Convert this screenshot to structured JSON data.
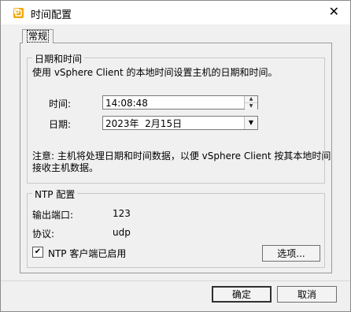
{
  "window": {
    "title": "时间配置",
    "close_glyph": "✕"
  },
  "tabs": [
    {
      "label": "常规"
    }
  ],
  "datetime_group": {
    "title": "日期和时间",
    "description": "使用 vSphere Client 的本地时间设置主机的日期和时间。",
    "time_label": "时间:",
    "time_value": "14:08:48",
    "date_label": "日期:",
    "date_value": "2023年  2月15日",
    "note_line1": "注意: 主机将处理日期和时间数据，以便 vSphere Client 按其本地时间",
    "note_line2": "接收主机数据。"
  },
  "ntp_group": {
    "title": "NTP 配置",
    "port_label": "输出端口:",
    "port_value": "123",
    "protocol_label": "协议:",
    "protocol_value": "udp",
    "client_enabled_label": "NTP 客户端已启用",
    "client_enabled": true,
    "options_button": "选项..."
  },
  "footer": {
    "ok_button": "确定",
    "cancel_button": "取消"
  },
  "icons": {
    "app": "vsphere-app-icon",
    "close": "close-icon",
    "spin_up": "spin-up-icon",
    "spin_down": "spin-down-icon",
    "dropdown": "chevron-down-icon",
    "check": "checkmark-icon"
  },
  "colors": {
    "app_icon": "#f5a800"
  }
}
